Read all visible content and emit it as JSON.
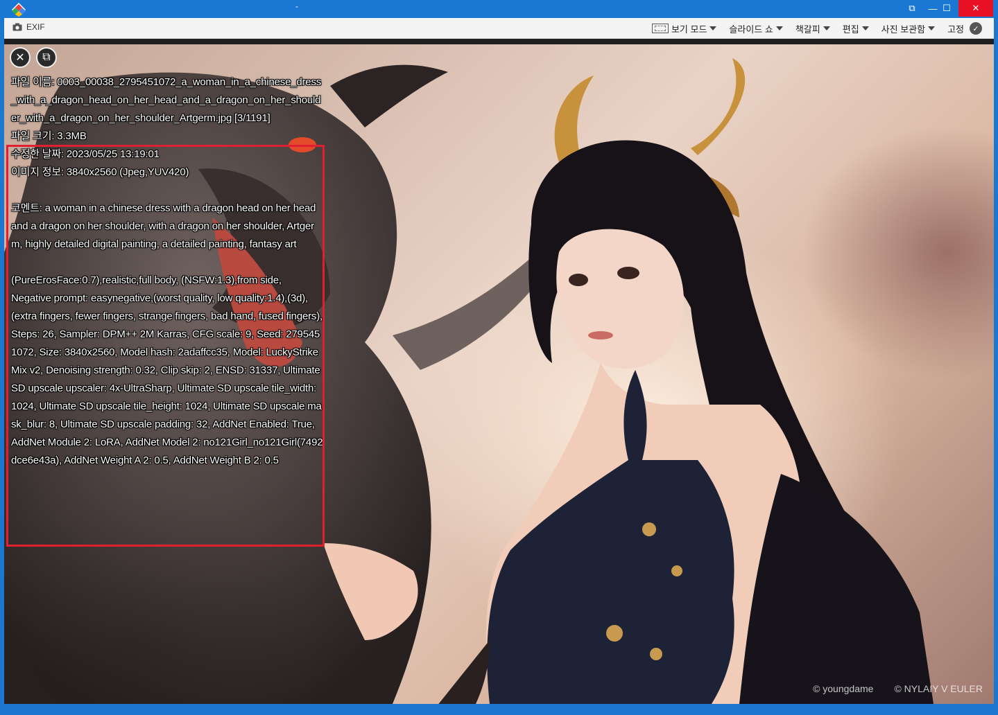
{
  "window": {
    "title": "-",
    "controls": {
      "restore": "⧉",
      "minimize": "—",
      "maximize": "☐",
      "close": "✕"
    }
  },
  "toolbar": {
    "exif_label": "EXIF",
    "menus": [
      {
        "label": "보기 모드"
      },
      {
        "label": "슬라이드 쇼"
      },
      {
        "label": "책갈피"
      },
      {
        "label": "편집"
      },
      {
        "label": "사진 보관함"
      }
    ],
    "pin_label": "고정",
    "pin_icon": "✓"
  },
  "viewer": {
    "close_icon": "✕",
    "copy_icon": "⧉",
    "info": {
      "filename": "파일 이름: 0003_00038_2795451072_a_woman_in_a_chinese_dress_with_a_dragon_head_on_her_head_and_a_dragon_on_her_shoulder_with_a_dragon_on_her_shoulder_Artgerm.jpg [3/1191]",
      "filesize": "파일 크기: 3.3MB",
      "modified": "수정한 날짜: 2023/05/25 13:19:01",
      "imageinfo": "이미지 정보: 3840x2560 (Jpeg,YUV420)",
      "comment": "코멘트: a woman in a chinese dress with a dragon head on her head and a dragon on her shoulder, with a dragon on her shoulder, Artgerm, highly detailed digital painting, a detailed painting, fantasy art",
      "prompt": "(PureErosFace:0.7),realistic,full body, (NSFW:1.3),from side,",
      "negative": "Negative prompt: easynegative,(worst quality, low quality:1.4),(3d),",
      "negative2": "(extra fingers, fewer fingers, strange fingers, bad hand, fused fingers),",
      "params": "Steps: 26, Sampler: DPM++ 2M Karras, CFG scale: 9, Seed: 2795451072, Size: 3840x2560, Model hash: 2adaffcc35, Model: LuckyStrikeMix v2, Denoising strength: 0.32, Clip skip: 2, ENSD: 31337, Ultimate SD upscale upscaler: 4x-UltraSharp, Ultimate SD upscale tile_width: 1024, Ultimate SD upscale tile_height: 1024, Ultimate SD upscale mask_blur: 8, Ultimate SD upscale padding: 32, AddNet Enabled: True, AddNet Module 2: LoRA, AddNet Model 2: no121Girl_no121Girl(7492dce6e43a), AddNet Weight A 2: 0.5, AddNet Weight B 2: 0.5"
    },
    "watermark_left": "© youngdame",
    "watermark_right": "© NYLAIY V EULER"
  },
  "colors": {
    "highlight": "#e02030",
    "titlebar": "#1a78d4"
  }
}
